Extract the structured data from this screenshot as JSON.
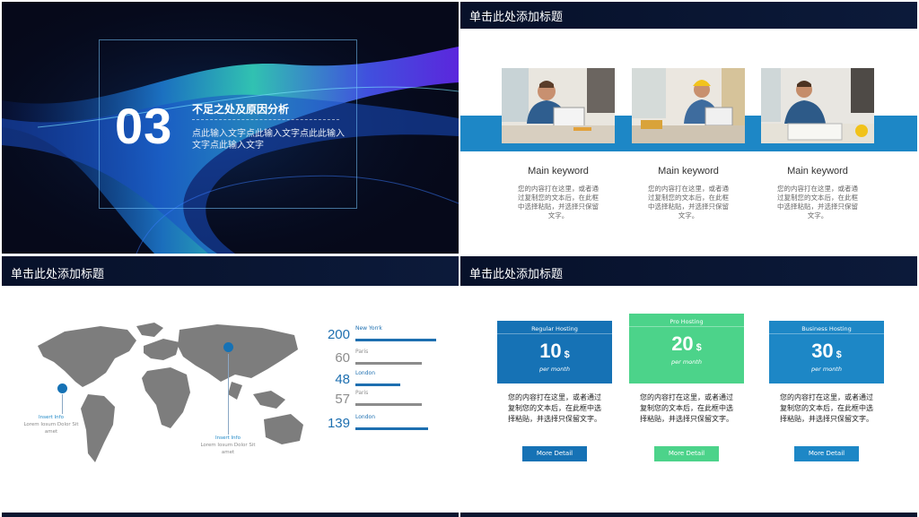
{
  "colors": {
    "navy": "#07112a",
    "blue": "#1d87c6",
    "green": "#4cd38a",
    "dark_blue": "#1672b5"
  },
  "slide1": {
    "number": "03",
    "heading": "不足之处及原因分析",
    "description": "点此输入文字点此输入文字点此此输入文字点此输入文字"
  },
  "slide2": {
    "title": "单击此处添加标题",
    "columns": [
      {
        "keyword": "Main keyword",
        "text": "您的内容打在这里，或者通过复制您的文本后，在此框中选择粘贴，并选择只保留文字。"
      },
      {
        "keyword": "Main keyword",
        "text": "您的内容打在这里，或者通过复制您的文本后，在此框中选择粘贴，并选择只保留文字。"
      },
      {
        "keyword": "Main keyword",
        "text": "您的内容打在这里，或者通过复制您的文本后，在此框中选择粘贴，并选择只保留文字。"
      }
    ]
  },
  "slide3": {
    "title": "单击此处添加标题",
    "pins": [
      {
        "label": "Insert Info",
        "text": "Lorem Iosum Dolor Sit amet"
      },
      {
        "label": "Insert Info",
        "text": "Lorem Iosum Dolor Sit amet"
      }
    ],
    "stats": [
      {
        "value": "200",
        "city": "New Yorrk",
        "color": "#1d6fb0",
        "fill": 1.0
      },
      {
        "value": "60",
        "city": "Paris",
        "color": "#8c8c8c",
        "fill": 0.82
      },
      {
        "value": "48",
        "city": "London",
        "color": "#1d6fb0",
        "fill": 0.55
      },
      {
        "value": "57",
        "city": "Paris",
        "color": "#8c8c8c",
        "fill": 0.82
      },
      {
        "value": "139",
        "city": "London",
        "color": "#1d6fb0",
        "fill": 0.9
      }
    ]
  },
  "slide4": {
    "title": "单击此处添加标题",
    "cards": [
      {
        "plan": "Regular Hosting",
        "price": "10",
        "currency": "$",
        "period": "per month",
        "text": "您的内容打在这里，或者通过复制您的文本后，在此框中选择粘贴，并选择只保留文字。",
        "button": "More Detail",
        "color": "#1672b5"
      },
      {
        "plan": "Pro Hosting",
        "price": "20",
        "currency": "$",
        "period": "per month",
        "text": "您的内容打在这里，或者通过复制您的文本后，在此框中选择粘贴，并选择只保留文字。",
        "button": "More Detail",
        "color": "#4cd38a"
      },
      {
        "plan": "Business Hosting",
        "price": "30",
        "currency": "$",
        "period": "per month",
        "text": "您的内容打在这里，或者通过复制您的文本后，在此框中选择粘贴，并选择只保留文字。",
        "button": "More Detail",
        "color": "#1d87c6"
      }
    ]
  }
}
